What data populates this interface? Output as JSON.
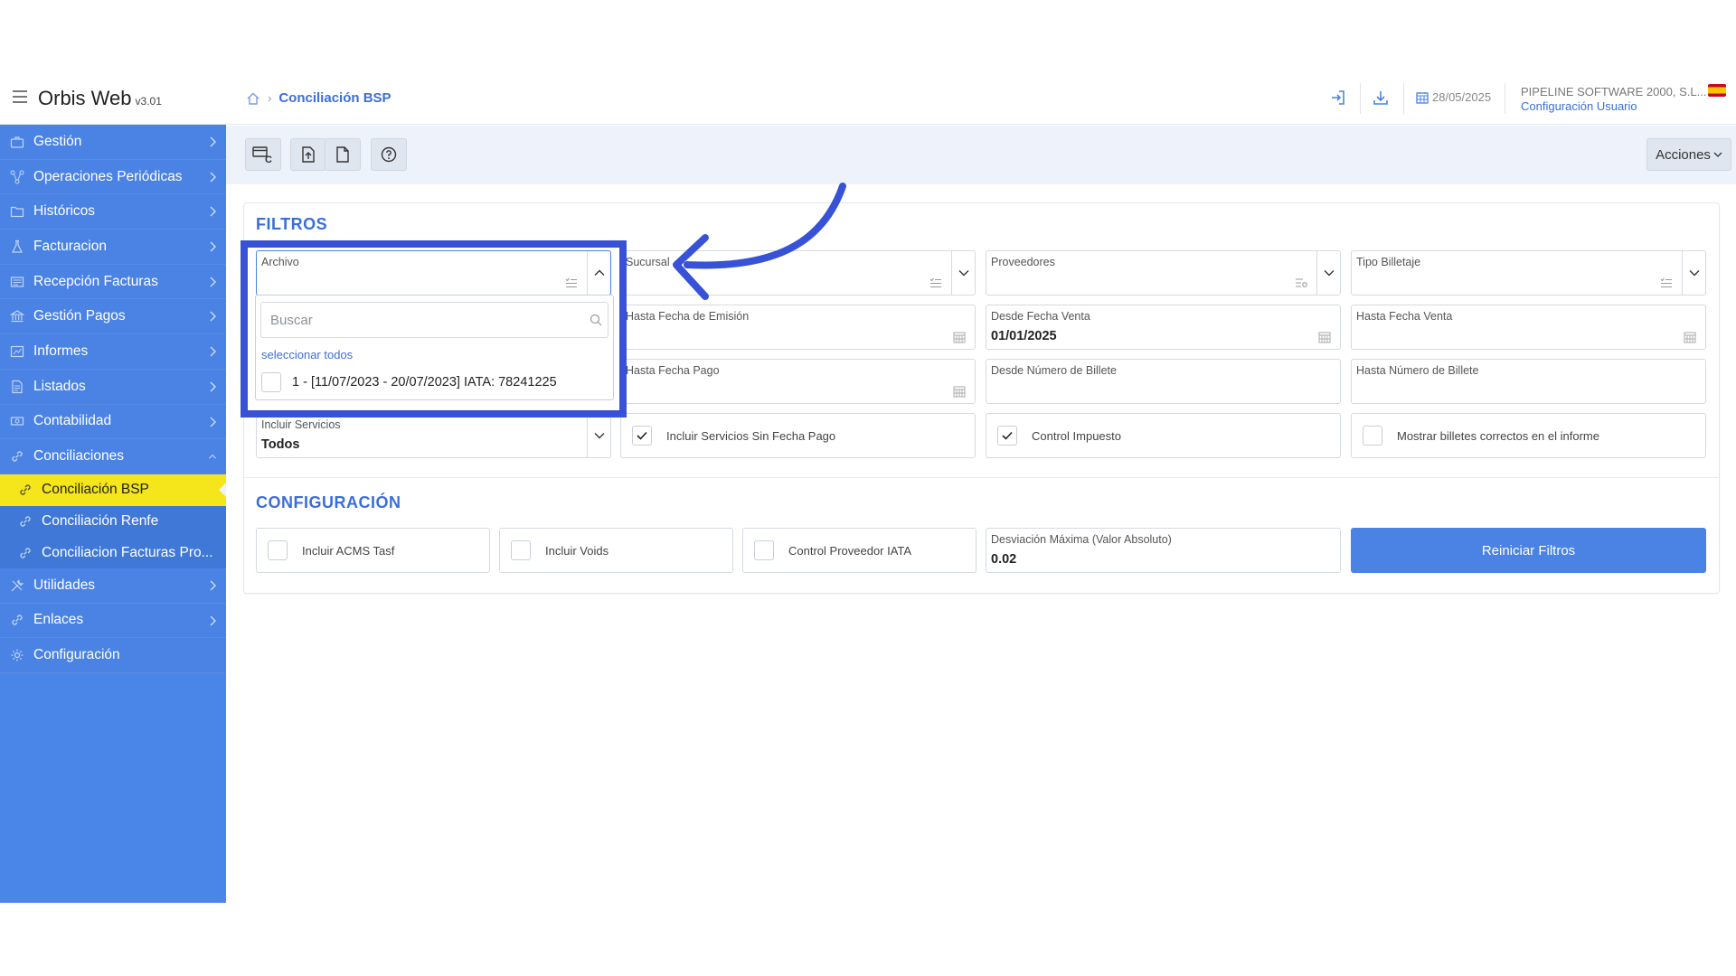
{
  "app": {
    "name": "Orbis Web",
    "version": "v3.01"
  },
  "breadcrumb": {
    "current": "Conciliación BSP"
  },
  "header": {
    "date": "28/05/2025",
    "company": "PIPELINE SOFTWARE 2000, S.L...",
    "config_link": "Configuración Usuario"
  },
  "sidebar": {
    "items": [
      {
        "label": "Gestión"
      },
      {
        "label": "Operaciones Periódicas"
      },
      {
        "label": "Históricos"
      },
      {
        "label": "Facturacion"
      },
      {
        "label": "Recepción Facturas"
      },
      {
        "label": "Gestión Pagos"
      },
      {
        "label": "Informes"
      },
      {
        "label": "Listados"
      },
      {
        "label": "Contabilidad"
      },
      {
        "label": "Conciliaciones"
      }
    ],
    "subitems": [
      {
        "label": "Conciliación BSP"
      },
      {
        "label": "Conciliación Renfe"
      },
      {
        "label": "Conciliacion Facturas Pro..."
      }
    ],
    "items_after": [
      {
        "label": "Utilidades"
      },
      {
        "label": "Enlaces"
      },
      {
        "label": "Configuración"
      }
    ]
  },
  "toolbar": {
    "acciones": "Acciones"
  },
  "filtros": {
    "title": "FILTROS",
    "archivo": {
      "label": "Archivo",
      "value": ""
    },
    "sucursal": {
      "label": "Sucursal",
      "value": ""
    },
    "proveedores": {
      "label": "Proveedores",
      "value": ""
    },
    "tipo_billetaje": {
      "label": "Tipo Billetaje",
      "value": ""
    },
    "hasta_fecha_emision": {
      "label": "Hasta Fecha de Emisión",
      "value": ""
    },
    "desde_fecha_venta": {
      "label": "Desde Fecha Venta",
      "value": "01/01/2025"
    },
    "hasta_fecha_venta": {
      "label": "Hasta Fecha Venta",
      "value": ""
    },
    "hasta_fecha_pago": {
      "label": "Hasta Fecha Pago",
      "value": ""
    },
    "desde_numero_billete": {
      "label": "Desde Número de Billete",
      "value": ""
    },
    "hasta_numero_billete": {
      "label": "Hasta Número de Billete",
      "value": ""
    },
    "incluir_servicios": {
      "label": "Incluir Servicios",
      "value": "Todos"
    },
    "chk_sin_fecha_pago": {
      "label": "Incluir Servicios Sin Fecha Pago",
      "checked": true
    },
    "chk_control_impuesto": {
      "label": "Control Impuesto",
      "checked": true
    },
    "chk_mostrar_correctos": {
      "label": "Mostrar billetes correctos en el informe",
      "checked": false
    }
  },
  "configuracion": {
    "title": "CONFIGURACIÓN",
    "chk_acms": {
      "label": "Incluir ACMS Tasf",
      "checked": false
    },
    "chk_voids": {
      "label": "Incluir Voids",
      "checked": false
    },
    "chk_control_iata": {
      "label": "Control Proveedor IATA",
      "checked": false
    },
    "desviacion": {
      "label": "Desviación Máxima (Valor Absoluto)",
      "value": "0.02"
    },
    "reset_button": "Reiniciar Filtros"
  },
  "dropdown": {
    "search_placeholder": "Buscar",
    "select_all": "seleccionar todos",
    "options": [
      {
        "label": "1 - [11/07/2023 - 20/07/2023] IATA: 78241225",
        "checked": false
      }
    ]
  },
  "colors": {
    "accent": "#4a83e4",
    "active": "#f5e51b",
    "annotation": "#3752d6"
  }
}
